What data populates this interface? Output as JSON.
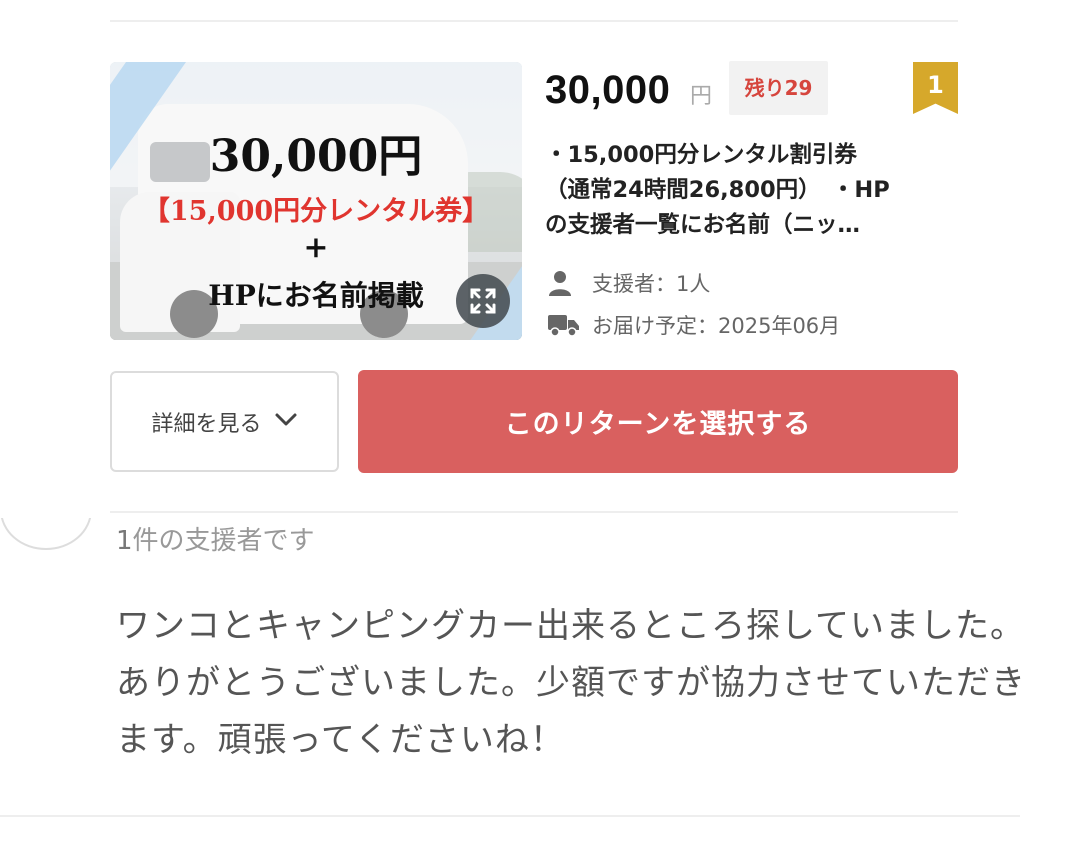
{
  "thumbnail": {
    "price_text": "30,000円",
    "red_text": "【15,000円分レンタル券】",
    "plus_text": "+",
    "hp_text": "HPにお名前掲載",
    "expand_icon": "expand-icon"
  },
  "reward": {
    "price": "30,000",
    "currency": "円",
    "remaining": "残り29",
    "rank": "1",
    "description_lines": [
      "・15,000円分レンタル割引券",
      "（通常24時間26,800円）　・HP",
      "の支援者一覧にお名前（ニッ…"
    ],
    "supporters": "支援者：1人",
    "delivery": "お届け予定：2025年06月"
  },
  "actions": {
    "detail_label": "詳細を見る",
    "select_label": "このリターンを選択する"
  },
  "supporter_section": {
    "count_number": "1",
    "count_suffix": "件の支援者です",
    "comment": "ワンコとキャンピングカー出来るところ探していました。ありがとうございました。少額ですが協力させていただきます。頑張ってくださいね！"
  },
  "colors": {
    "accent_button": "#d9605f",
    "remaining_text": "#d6453d",
    "rank_badge": "#d6a82b",
    "thumbnail_red": "#e0352f"
  }
}
